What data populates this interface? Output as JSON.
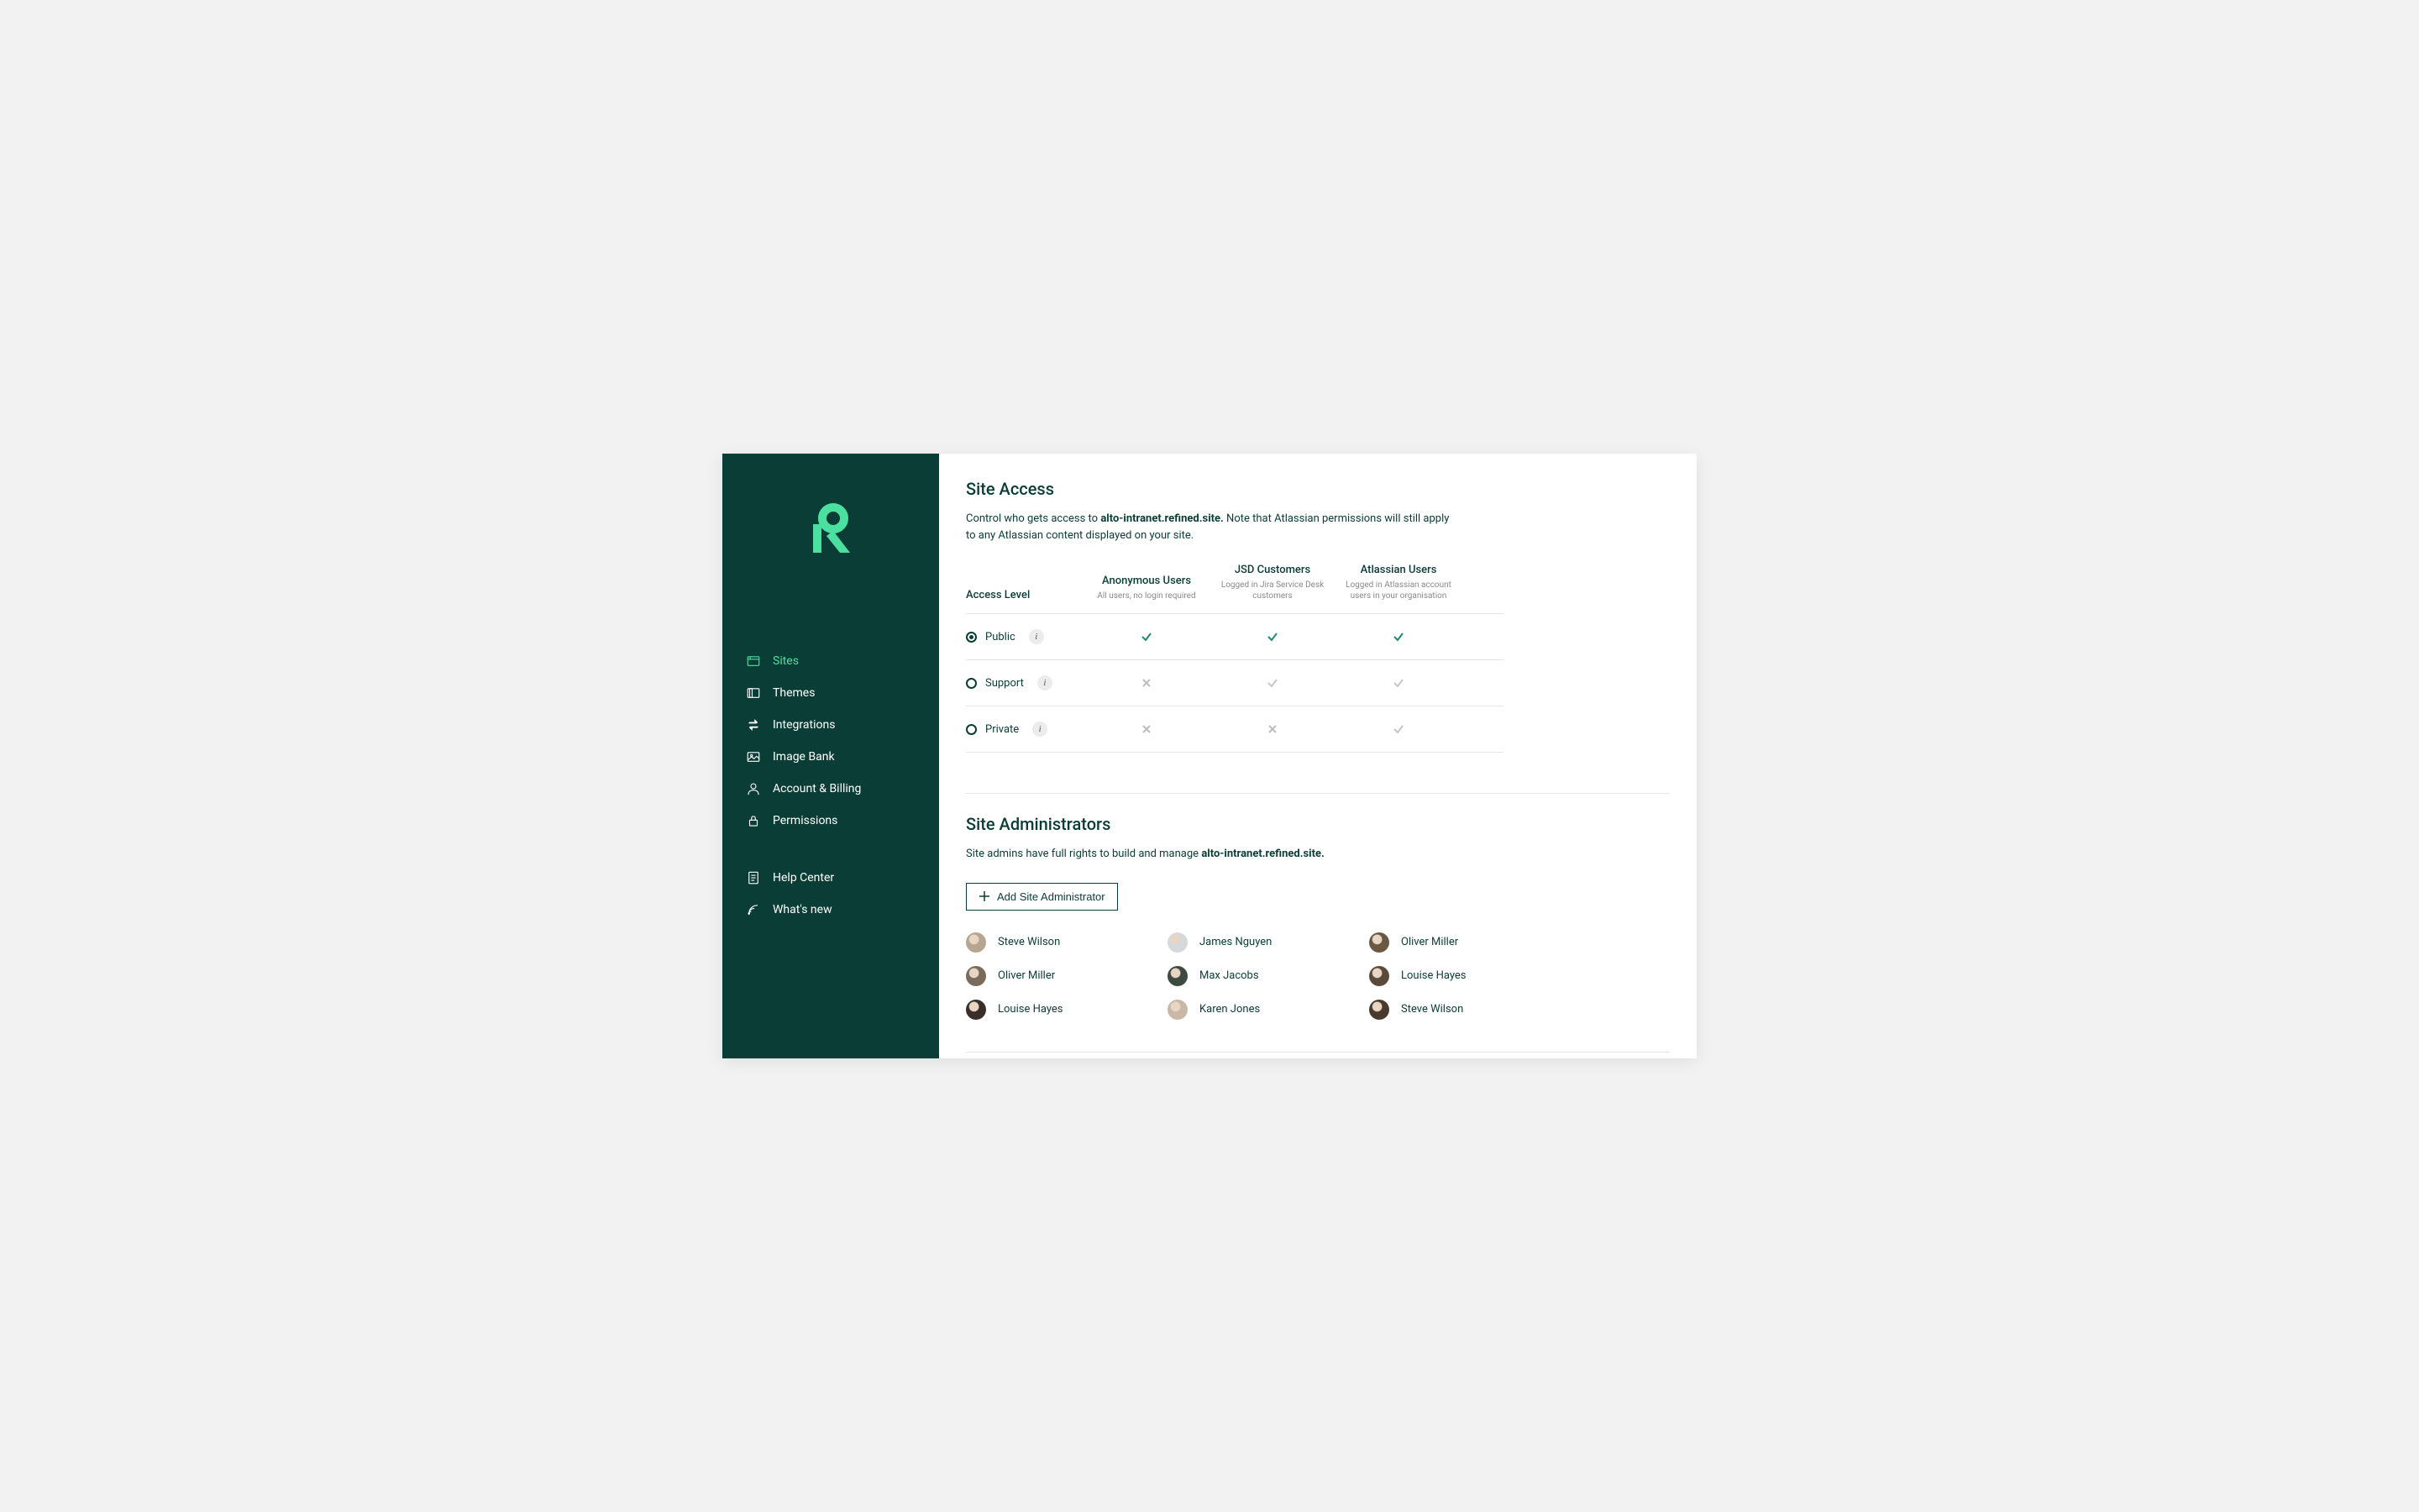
{
  "sidebar": {
    "nav_main": [
      {
        "label": "Sites",
        "icon": "sites",
        "active": true
      },
      {
        "label": "Themes",
        "icon": "themes",
        "active": false
      },
      {
        "label": "Integrations",
        "icon": "integrations",
        "active": false
      },
      {
        "label": "Image Bank",
        "icon": "imagebank",
        "active": false
      },
      {
        "label": "Account & Billing",
        "icon": "account",
        "active": false
      },
      {
        "label": "Permissions",
        "icon": "permissions",
        "active": false
      }
    ],
    "nav_secondary": [
      {
        "label": "Help Center",
        "icon": "help",
        "active": false
      },
      {
        "label": "What's new",
        "icon": "whatsnew",
        "active": false
      }
    ]
  },
  "site_access": {
    "title": "Site Access",
    "desc_prefix": "Control who gets access to ",
    "site_name": "alto-intranet.refined.site.",
    "desc_suffix": " Note that Atlassian permissions will still apply to any Atlassian content displayed on your site.",
    "header_label": "Access Level",
    "columns": [
      {
        "title": "Anonymous Users",
        "sub": "All users, no login required"
      },
      {
        "title": "JSD Customers",
        "sub": "Logged in Jira Service Desk customers"
      },
      {
        "title": "Atlassian Users",
        "sub": "Logged in Atlassian account users in your organisation"
      }
    ],
    "rows": [
      {
        "label": "Public",
        "selected": true,
        "cells": [
          "check-on",
          "check-on",
          "check-on"
        ]
      },
      {
        "label": "Support",
        "selected": false,
        "cells": [
          "x",
          "check-off",
          "check-off"
        ]
      },
      {
        "label": "Private",
        "selected": false,
        "cells": [
          "x",
          "x",
          "check-off"
        ]
      }
    ]
  },
  "site_admins": {
    "title": "Site Administrators",
    "desc_prefix": "Site admins have full rights to build and manage ",
    "site_name": "alto-intranet.refined.site.",
    "add_label": "Add Site Administrator",
    "people": [
      {
        "name": "Steve Wilson",
        "color": "#b8a58f"
      },
      {
        "name": "James Nguyen",
        "color": "#d5d9dc"
      },
      {
        "name": "Oliver Miller",
        "color": "#6b5843"
      },
      {
        "name": "Oliver Miller",
        "color": "#7a6a5a"
      },
      {
        "name": "Max Jacobs",
        "color": "#3e4a3f"
      },
      {
        "name": "Louise Hayes",
        "color": "#5a4a3a"
      },
      {
        "name": "Louise Hayes",
        "color": "#3a2e2a"
      },
      {
        "name": "Karen Jones",
        "color": "#c9b8a8"
      },
      {
        "name": "Steve Wilson",
        "color": "#4a3a2e"
      }
    ]
  }
}
